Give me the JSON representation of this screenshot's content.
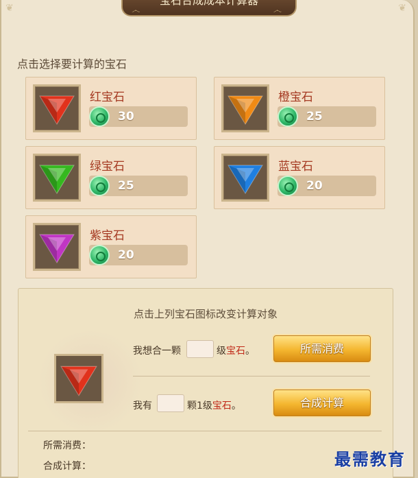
{
  "header": {
    "title": "宝石合成成本计算器"
  },
  "gem_section": {
    "title": "点击选择要计算的宝石"
  },
  "gems": [
    {
      "name": "红宝石",
      "cost": "30",
      "color": "#e1321c"
    },
    {
      "name": "橙宝石",
      "cost": "25",
      "color": "#f08a15"
    },
    {
      "name": "绿宝石",
      "cost": "25",
      "color": "#35b81f"
    },
    {
      "name": "蓝宝石",
      "cost": "20",
      "color": "#1f7fe0"
    },
    {
      "name": "紫宝石",
      "cost": "20",
      "color": "#c035c4"
    }
  ],
  "calculator": {
    "hint": "点击上列宝石图标改变计算对象",
    "selected_gem_color": "#e1321c",
    "row1": {
      "prefix": "我想合一颗",
      "suffix": "级",
      "gem": "宝石",
      "end": "。",
      "button": "所需消费"
    },
    "row2": {
      "prefix": "我有",
      "suffix": "颗1级",
      "gem": "宝石",
      "end": "。",
      "button": "合成计算"
    },
    "results": {
      "cost_label": "所需消费：",
      "calc_label": "合成计算："
    }
  },
  "watermark": "最需教育"
}
